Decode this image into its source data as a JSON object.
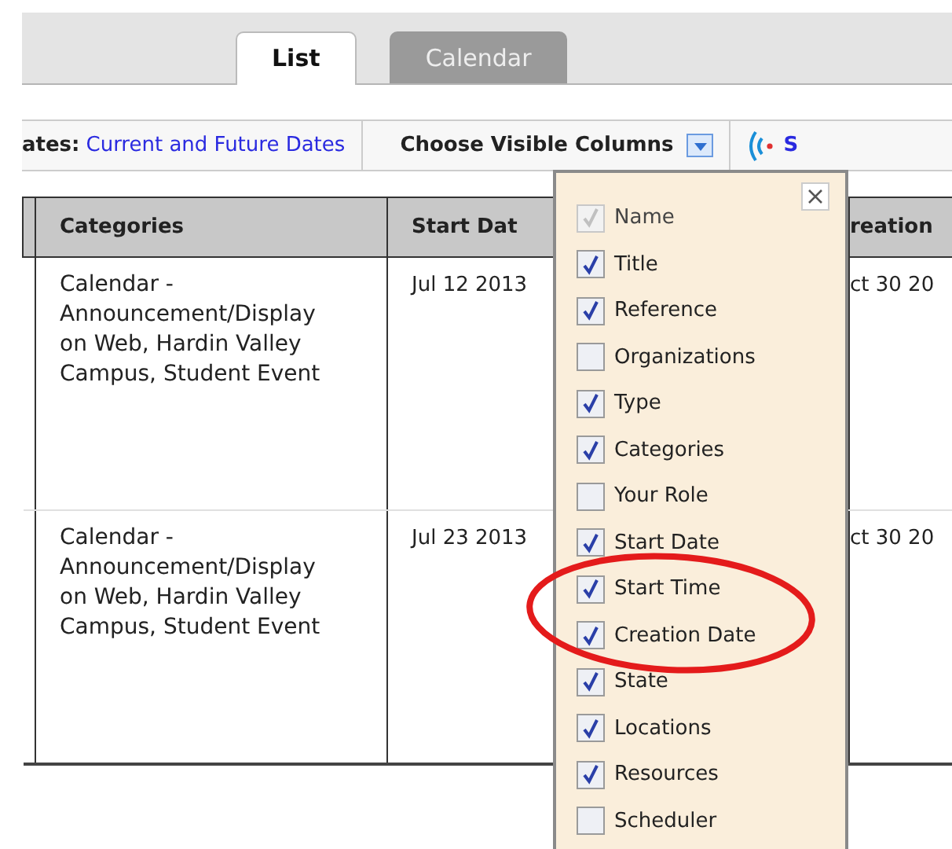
{
  "tabs": [
    {
      "label": "List",
      "selected": true
    },
    {
      "label": "Calendar",
      "selected": false
    }
  ],
  "toolbar": {
    "dates_label": "ates:",
    "dates_value": "Current and Future Dates",
    "columns_button": "Choose Visible Columns",
    "feed_label": "S"
  },
  "table": {
    "columns": [
      "Categories",
      "Start Dat",
      "reation"
    ],
    "rows": [
      [
        "Calendar - Announcement/Display on Web, Hardin Valley Campus, Student Event",
        "Jul 12 2013",
        "ct 30 20"
      ],
      [
        "Calendar - Announcement/Display on Web, Hardin Valley Campus, Student Event",
        "Jul 23 2013",
        "ct 30 20"
      ]
    ]
  },
  "column_chooser": {
    "items": [
      {
        "label": "Name",
        "checked": true,
        "disabled": true
      },
      {
        "label": "Title",
        "checked": true,
        "disabled": false
      },
      {
        "label": "Reference",
        "checked": true,
        "disabled": false
      },
      {
        "label": "Organizations",
        "checked": false,
        "disabled": false
      },
      {
        "label": "Type",
        "checked": true,
        "disabled": false
      },
      {
        "label": "Categories",
        "checked": true,
        "disabled": false
      },
      {
        "label": "Your Role",
        "checked": false,
        "disabled": false
      },
      {
        "label": "Start Date",
        "checked": true,
        "disabled": false
      },
      {
        "label": "Start Time",
        "checked": true,
        "disabled": false
      },
      {
        "label": "Creation Date",
        "checked": true,
        "disabled": false
      },
      {
        "label": "State",
        "checked": true,
        "disabled": false
      },
      {
        "label": "Locations",
        "checked": true,
        "disabled": false
      },
      {
        "label": "Resources",
        "checked": true,
        "disabled": false
      },
      {
        "label": "Scheduler",
        "checked": false,
        "disabled": false
      }
    ]
  }
}
